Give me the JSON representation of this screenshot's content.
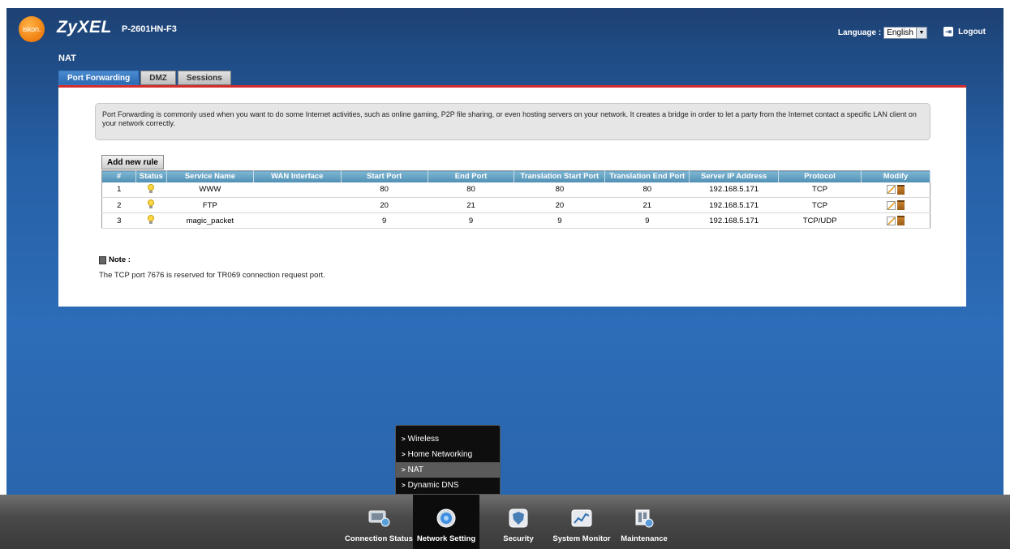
{
  "header": {
    "isp_logo": "iskon.",
    "brand": "ZyXEL",
    "model": "P-2601HN-F3",
    "language_label": "Language :",
    "language_value": "English",
    "logout_label": "Logout"
  },
  "page_title": "NAT",
  "tabs": [
    {
      "label": "Port Forwarding",
      "active": true
    },
    {
      "label": "DMZ",
      "active": false
    },
    {
      "label": "Sessions",
      "active": false
    }
  ],
  "info_text": "Port Forwarding is commonly used when you want to do some Internet activities, such as online gaming, P2P file sharing, or even hosting servers on your network. It creates a bridge in order to let a party from the Internet contact a specific LAN client on your network correctly.",
  "add_rule_label": "Add new rule",
  "table": {
    "headers": [
      "#",
      "Status",
      "Service Name",
      "WAN Interface",
      "Start Port",
      "End Port",
      "Translation Start Port",
      "Translation End Port",
      "Server IP Address",
      "Protocol",
      "Modify"
    ],
    "rows": [
      {
        "num": "1",
        "service": "WWW",
        "wan": "",
        "start": "80",
        "end": "80",
        "tstart": "80",
        "tend": "80",
        "ip": "192.168.5.171",
        "protocol": "TCP"
      },
      {
        "num": "2",
        "service": "FTP",
        "wan": "",
        "start": "20",
        "end": "21",
        "tstart": "20",
        "tend": "21",
        "ip": "192.168.5.171",
        "protocol": "TCP"
      },
      {
        "num": "3",
        "service": "magic_packet",
        "wan": "",
        "start": "9",
        "end": "9",
        "tstart": "9",
        "tend": "9",
        "ip": "192.168.5.171",
        "protocol": "TCP/UDP"
      }
    ]
  },
  "note": {
    "title": "Note :",
    "text": "The TCP port 7676 is reserved for TR069 connection request port."
  },
  "submenu": [
    {
      "label": "Wireless",
      "active": false
    },
    {
      "label": "Home Networking",
      "active": false
    },
    {
      "label": "NAT",
      "active": true
    },
    {
      "label": "Dynamic DNS",
      "active": false
    }
  ],
  "bottom_nav": [
    {
      "label": "Connection Status",
      "icon": "connection-status-icon",
      "active": false
    },
    {
      "label": "Network Setting",
      "icon": "network-setting-icon",
      "active": true
    },
    {
      "label": "Security",
      "icon": "security-shield-icon",
      "active": false
    },
    {
      "label": "System Monitor",
      "icon": "system-monitor-icon",
      "active": false
    },
    {
      "label": "Maintenance",
      "icon": "maintenance-icon",
      "active": false
    }
  ],
  "colors": {
    "accent_red": "#d32d2d",
    "header_blue": "#1f4a82",
    "table_header": "#5e9cc0"
  }
}
